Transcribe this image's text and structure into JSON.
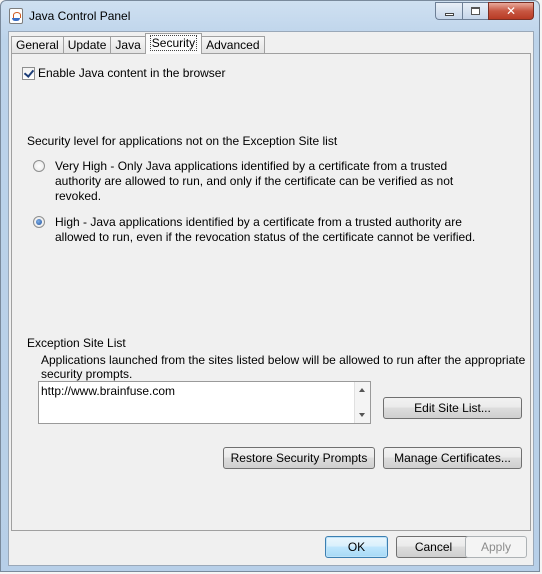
{
  "window": {
    "title": "Java Control Panel",
    "close_glyph": "✕"
  },
  "tabs": [
    {
      "label": "General"
    },
    {
      "label": "Update"
    },
    {
      "label": "Java"
    },
    {
      "label": "Security",
      "active": true
    },
    {
      "label": "Advanced"
    }
  ],
  "security": {
    "enable_checkbox_label": "Enable Java content in the browser",
    "enable_checked": true,
    "level_heading": "Security level for applications not on the Exception Site list",
    "levels": [
      {
        "label": "Very High - Only Java applications identified by a certificate from a trusted authority are allowed to run, and only if the certificate can be verified as not revoked.",
        "selected": false
      },
      {
        "label": "High - Java applications identified by a certificate from a trusted authority are allowed to run, even if the revocation status of the certificate cannot be verified.",
        "selected": true
      }
    ],
    "exception_heading": "Exception Site List",
    "exception_description": "Applications launched from the sites listed below will be allowed to run after the appropriate security prompts.",
    "sites": [
      "http://www.brainfuse.com"
    ],
    "edit_site_list_label": "Edit Site List...",
    "restore_prompts_label": "Restore Security Prompts",
    "manage_certificates_label": "Manage Certificates..."
  },
  "dialog_buttons": {
    "ok_label": "OK",
    "cancel_label": "Cancel",
    "apply_label": "Apply"
  },
  "colors": {
    "accent": "#3c7fb1",
    "close_button": "#c85742"
  }
}
